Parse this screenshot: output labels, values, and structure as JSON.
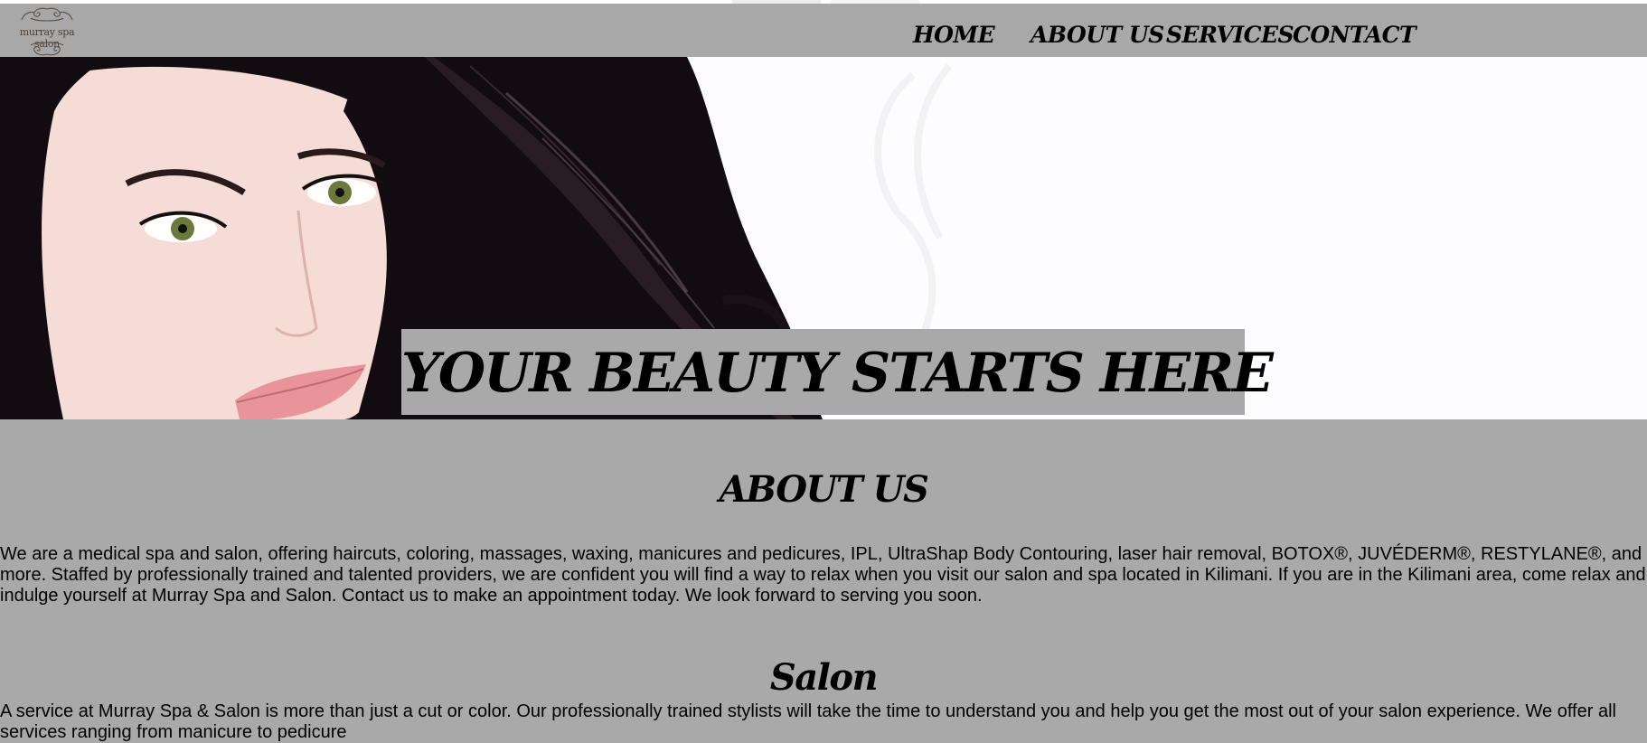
{
  "brand": {
    "logo_text": "murray spa salon"
  },
  "nav": {
    "items": [
      "HOME",
      "ABOUT US",
      "SERVICES",
      "CONTACT"
    ]
  },
  "hero": {
    "tagline": "YOUR BEAUTY  STARTS HERE"
  },
  "about": {
    "heading": "ABOUT US",
    "body": "We are a medical spa and salon, offering haircuts, coloring, massages, waxing, manicures and pedicures, IPL, UltraShap Body Contouring, laser hair removal, BOTOX®, JUVÉDERM®, RESTYLANE®, and more. Staffed by professionally trained and talented providers, we are confident you will find a way to relax when you visit our salon and spa located in Kilimani. If you are in the Kilimani area, come relax and indulge yourself at Murray Spa and Salon. Contact us to make an appointment today. We look forward to serving you soon."
  },
  "salon": {
    "heading": "Salon",
    "body": "A service at Murray Spa & Salon is more than just a cut or color. Our professionally trained stylists will take the time to understand you and help you get the most out of your salon experience. We offer all services ranging from manicure to pedicure"
  },
  "colors": {
    "header_bg": "#a8a8a8",
    "page_bg": "#a9a9a9",
    "hero_bg": "#fdfcfe"
  }
}
